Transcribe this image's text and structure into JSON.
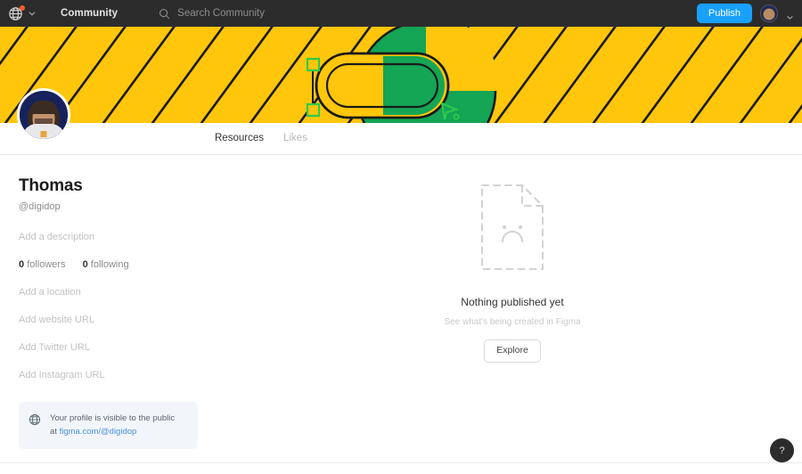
{
  "topbar": {
    "globe_icon": "globe-icon",
    "notification_dot_color": "#ff5c28",
    "menu_chevron_icon": "chevron-down-icon",
    "community_label": "Community",
    "search_icon": "search-icon",
    "search_placeholder": "Search Community",
    "search_value": "",
    "publish_label": "Publish",
    "publish_color": "#18a0fb",
    "avatar_icon": "user-avatar",
    "account_chevron_icon": "chevron-down-icon",
    "background_color": "#2c2c2c"
  },
  "banner": {
    "background_color": "#ffc60b",
    "stripe_color": "#1a1a1a",
    "shape_color": "#14a555",
    "selection_handle_color": "#2ecc4a",
    "cursor_icon": "design-cursor-icon"
  },
  "profile": {
    "avatar_icon": "profile-avatar",
    "name": "Thomas",
    "handle": "@digidop",
    "description_placeholder": "Add a description",
    "stats": [
      {
        "count": "0",
        "label": "followers"
      },
      {
        "count": "0",
        "label": "following"
      }
    ],
    "meta_fields": [
      {
        "name": "location",
        "placeholder": "Add a location"
      },
      {
        "name": "website",
        "placeholder": "Add website URL"
      },
      {
        "name": "twitter",
        "placeholder": "Add Twitter URL"
      },
      {
        "name": "instagram",
        "placeholder": "Add Instagram URL"
      }
    ],
    "visibility": {
      "icon": "globe-icon",
      "line1": "Your profile is visible to the public",
      "line2_prefix": "at ",
      "line2_link": "figma.com/@digidop",
      "background_color": "#f2f6fb",
      "link_color": "#4a8fe0"
    }
  },
  "tabs": [
    {
      "label": "Resources",
      "active": true
    },
    {
      "label": "Likes",
      "active": false
    }
  ],
  "empty_state": {
    "illustration_icon": "empty-document-sad-face-icon",
    "title": "Nothing published yet",
    "subtitle": "See what's being created in Figma",
    "button_label": "Explore"
  },
  "help": {
    "label": "?",
    "icon": "help-icon"
  }
}
